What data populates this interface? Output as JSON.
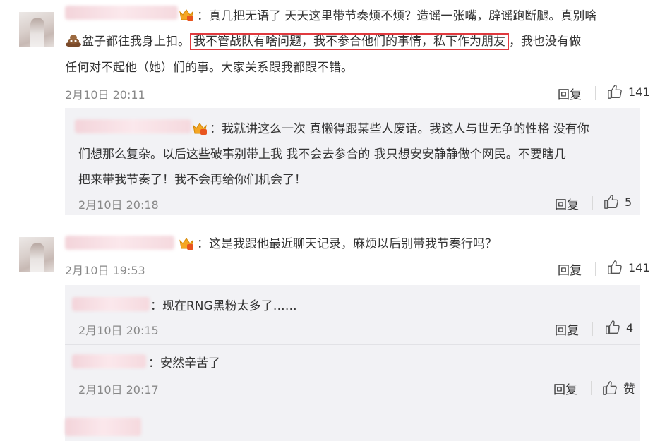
{
  "comments": [
    {
      "text_before": "：真几把无语了  天天这里带节奏烦不烦？造谣一张嘴，辟谣跑断腿。真别啥",
      "text_line2_after_emoji": "盆子都往我身上扣。",
      "highlighted": "我不管战队有啥问题，我不参合他们的事情，私下作为朋友",
      "text_after": "，我也没有做",
      "text_line3": "任何对不起他（她）们的事。大家关系跟我都跟不错。",
      "time": "2月10日 20:11",
      "reply_label": "回复",
      "like_count": "141",
      "replies": [
        {
          "line1": "：我就讲这么一次 真懒得跟某些人废话。我这人与世无争的性格 没有你",
          "line2": "们想那么复杂。以后这些破事别带上我 我不会去参合的 我只想安安静静做个网民。不要瞎几",
          "line3": "把来带我节奏了！我不会再给你们机会了！",
          "time": "2月10日 20:18",
          "reply_label": "回复",
          "like_count": "5"
        }
      ]
    },
    {
      "text": "：这是我跟他最近聊天记录，麻烦以后别带我节奏行吗？",
      "time": "2月10日 19:53",
      "reply_label": "回复",
      "like_count": "141",
      "replies": [
        {
          "text": "：现在RNG黑粉太多了……",
          "time": "2月10日 20:15",
          "reply_label": "回复",
          "like_count": "4"
        },
        {
          "text": "：安然辛苦了",
          "time": "2月10日 20:17",
          "reply_label": "回复",
          "like_label": "赞"
        }
      ]
    }
  ],
  "colors": {
    "highlight_border": "#e0393e",
    "reply_bg": "#f2f2f5",
    "time": "#888888"
  },
  "icons": [
    "thumb-up-icon",
    "crown-badge-icon",
    "poop-emoji-icon"
  ]
}
